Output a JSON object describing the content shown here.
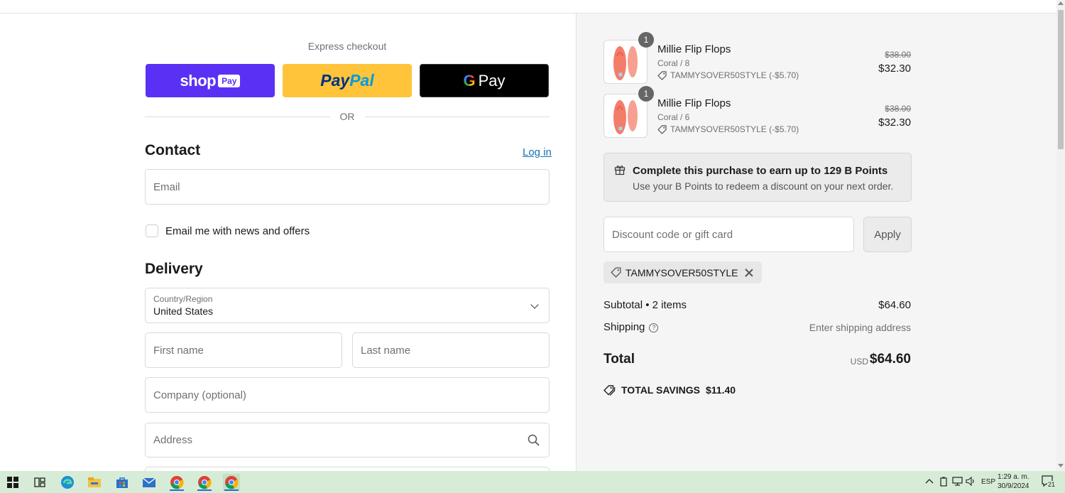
{
  "express": {
    "title": "Express checkout",
    "shoppay_brand": "shop",
    "shoppay_pill": "Pay",
    "paypal_a": "Pay",
    "paypal_b": "Pal",
    "gpay_g": "G",
    "gpay_label": "Pay",
    "or_text": "OR"
  },
  "contact": {
    "heading": "Contact",
    "login_link": "Log in",
    "email_placeholder": "Email",
    "newsletter_label": "Email me with news and offers"
  },
  "delivery": {
    "heading": "Delivery",
    "country_label": "Country/Region",
    "country_value": "United States",
    "first_name_placeholder": "First name",
    "last_name_placeholder": "Last name",
    "company_placeholder": "Company (optional)",
    "address_placeholder": "Address"
  },
  "cart": {
    "items": [
      {
        "qty": "1",
        "name": "Millie Flip Flops",
        "variant": "Coral / 8",
        "discount": "TAMMYSOVER50STYLE (-$5.70)",
        "old_price": "$38.00",
        "price": "$32.30"
      },
      {
        "qty": "1",
        "name": "Millie Flip Flops",
        "variant": "Coral / 6",
        "discount": "TAMMYSOVER50STYLE (-$5.70)",
        "old_price": "$38.00",
        "price": "$32.30"
      }
    ],
    "points_title": "Complete this purchase to earn up to 129 B Points",
    "points_sub": "Use your B Points to redeem a discount on your next order.",
    "discount_placeholder": "Discount code or gift card",
    "apply_label": "Apply",
    "applied_code": "TAMMYSOVER50STYLE",
    "subtotal_label": "Subtotal • 2 items",
    "subtotal_value": "$64.60",
    "shipping_label": "Shipping",
    "shipping_help": "?",
    "shipping_value": "Enter shipping address",
    "total_label": "Total",
    "total_currency": "USD",
    "total_value": "$64.60",
    "savings_label": "TOTAL SAVINGS",
    "savings_value": "$11.40"
  },
  "taskbar": {
    "language": "ESP",
    "time": "1:29 a. m.",
    "date": "30/9/2024",
    "notification_count": "21"
  },
  "colors": {
    "shoppay": "#5a31f4",
    "paypal": "#ffc439",
    "gpay": "#000000",
    "link": "#1773b0",
    "product": "#f47c6a"
  }
}
